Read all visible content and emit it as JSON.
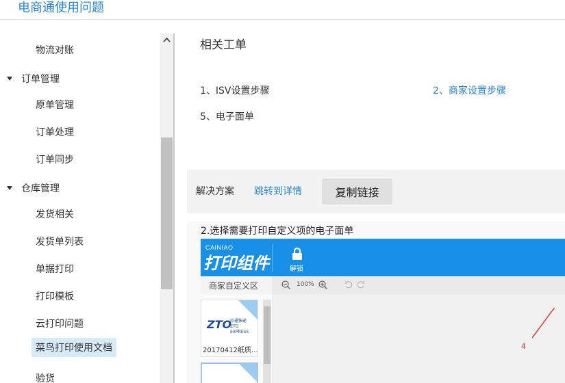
{
  "header": {
    "title": "电商通使用问题"
  },
  "sidebar": {
    "items": [
      {
        "label": "物流对账"
      },
      {
        "label": "订单管理"
      },
      {
        "label": "原单管理"
      },
      {
        "label": "订单处理"
      },
      {
        "label": "订单同步"
      },
      {
        "label": "仓库管理"
      },
      {
        "label": "发货相关"
      },
      {
        "label": "发货单列表"
      },
      {
        "label": "单据打印"
      },
      {
        "label": "打印模板"
      },
      {
        "label": "云打印问题"
      },
      {
        "label": "菜鸟打印使用文档"
      },
      {
        "label": "验货"
      }
    ]
  },
  "main": {
    "related_title": "相关工单",
    "tickets": [
      {
        "label": "1、ISV设置步骤"
      },
      {
        "label": "2、商家设置步骤"
      },
      {
        "label": "5、电子面单"
      }
    ],
    "solution": {
      "label": "解决方案",
      "link": "跳转到详情",
      "copy_button": "复制链接"
    },
    "step_text": "2.选择需要打印自定义项的电子面单"
  },
  "screenshot": {
    "brand": "CAINIAO",
    "app_title": "打印组件",
    "unlock_label": "解锁",
    "merchant_area": "商家自定义区",
    "zoom": "100%",
    "zto_logo": "ZTO",
    "zto_cn": "中通快递",
    "zto_en": "ZTO EXPRESS",
    "card_label": "20170412纸质…",
    "annotation": "4"
  },
  "colors": {
    "link": "#2a87d4",
    "toolbar": "#1890e8",
    "active_bg": "#d6eaf8",
    "annotation": "#e53935"
  }
}
